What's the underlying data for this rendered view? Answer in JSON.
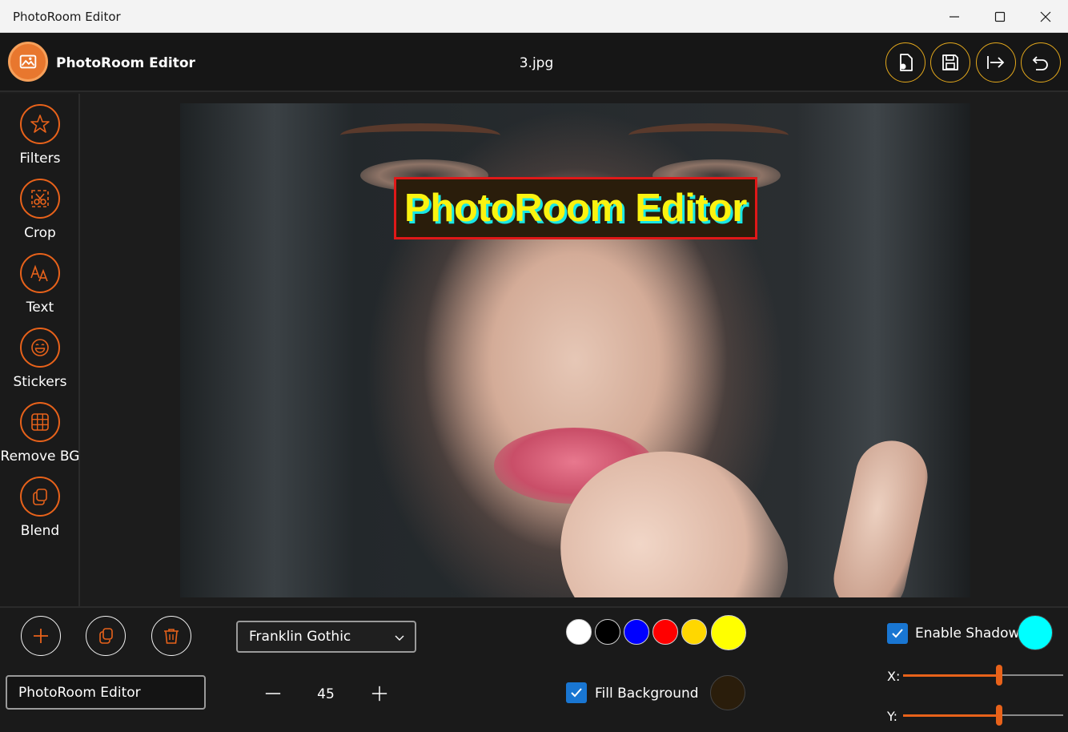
{
  "window": {
    "title": "PhotoRoom Editor"
  },
  "header": {
    "app_name": "PhotoRoom Editor",
    "file_name": "3.jpg",
    "accent_color": "#e3a81c",
    "buttons": [
      {
        "name": "open-file",
        "icon": "file-image-icon"
      },
      {
        "name": "save",
        "icon": "floppy-icon"
      },
      {
        "name": "export",
        "icon": "arrow-right-bar-icon"
      },
      {
        "name": "undo",
        "icon": "undo-icon"
      }
    ]
  },
  "sidebar": {
    "accent_color": "#e8621a",
    "items": [
      {
        "label": "Filters",
        "icon": "star-icon"
      },
      {
        "label": "Crop",
        "icon": "crop-icon"
      },
      {
        "label": "Text",
        "icon": "text-icon"
      },
      {
        "label": "Stickers",
        "icon": "smiley-icon"
      },
      {
        "label": "Remove BG",
        "icon": "grid-icon"
      },
      {
        "label": "Blend",
        "icon": "copy-icon"
      }
    ]
  },
  "canvas": {
    "overlay_text": "PhotoRoom Editor",
    "overlay_text_color": "#fbf310",
    "overlay_shadow_color": "#18e6e6",
    "overlay_bg_color": "#2a1d0b",
    "overlay_border_color": "#e01818"
  },
  "bottom": {
    "actions": [
      {
        "name": "add",
        "icon": "plus-icon"
      },
      {
        "name": "duplicate",
        "icon": "copy-icon"
      },
      {
        "name": "delete",
        "icon": "trash-icon"
      }
    ],
    "font_select": {
      "value": "Franklin Gothic"
    },
    "text_input": {
      "value": "PhotoRoom Editor"
    },
    "font_size": "45",
    "colors": [
      "#ffffff",
      "#000000",
      "#0000ff",
      "#ff0000",
      "#ffd700"
    ],
    "selected_color": "#ffff00",
    "fill_background": {
      "label": "Fill Background",
      "checked": true,
      "color": "#2a1d0b"
    },
    "enable_shadow": {
      "label": "Enable Shadow",
      "checked": true,
      "color": "#00ffff"
    },
    "shadow_x": {
      "label": "X:",
      "value": 0.6
    },
    "shadow_y": {
      "label": "Y:",
      "value": 0.6
    }
  }
}
